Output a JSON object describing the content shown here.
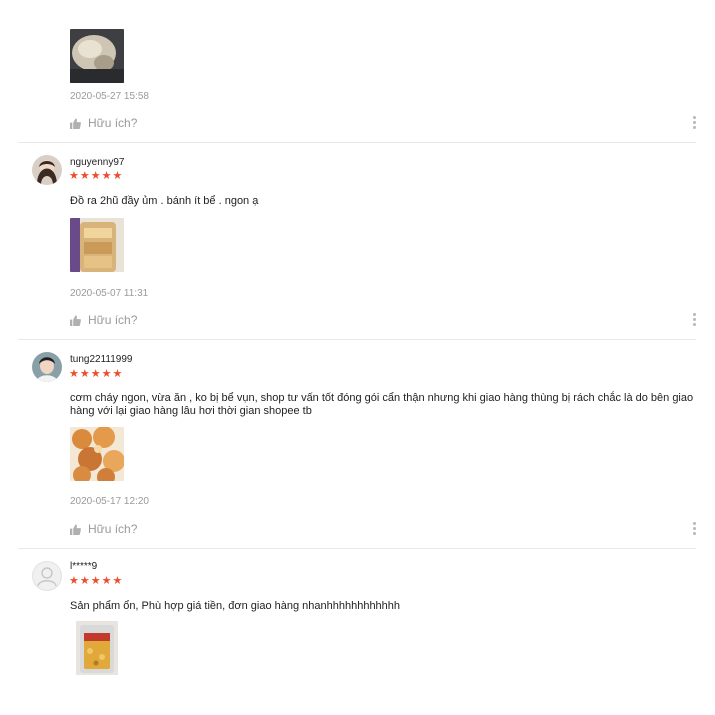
{
  "reviews": [
    {
      "username": "",
      "stars": "★★★★★",
      "comment": "",
      "timestamp": "2020-05-27 15:58",
      "helpful_label": "Hữu ích?"
    },
    {
      "username": "nguyenny97",
      "stars": "★★★★★",
      "comment": "Đồ ra 2hũ đầy ủm . bánh ít bể . ngon ạ",
      "timestamp": "2020-05-07 11:31",
      "helpful_label": "Hữu ích?"
    },
    {
      "username": "tung22111999",
      "stars": "★★★★★",
      "comment": "cơm cháy ngon, vừa ăn , ko bị bể vụn, shop tư vấn tốt đóng gói cẩn thận nhưng khi giao hàng thùng bị rách chắc là do bên giao hàng với lại giao hàng lâu hơi thời gian shopee tb",
      "timestamp": "2020-05-17 12:20",
      "helpful_label": "Hữu ích?"
    },
    {
      "username": "l*****9",
      "stars": "★★★★★",
      "comment": "Sản phẩm ổn, Phù hợp giá tiền, đơn giao hàng nhanhhhhhhhhhhhh",
      "timestamp": "",
      "helpful_label": ""
    }
  ],
  "colors": {
    "star": "#ee4d2d",
    "meta_text": "#9a9a9a",
    "divider": "#e8e8e8"
  },
  "icons": {
    "helpful": "thumbs-up-icon",
    "more": "more-vertical-icon",
    "avatar_default": "user-placeholder-icon"
  }
}
